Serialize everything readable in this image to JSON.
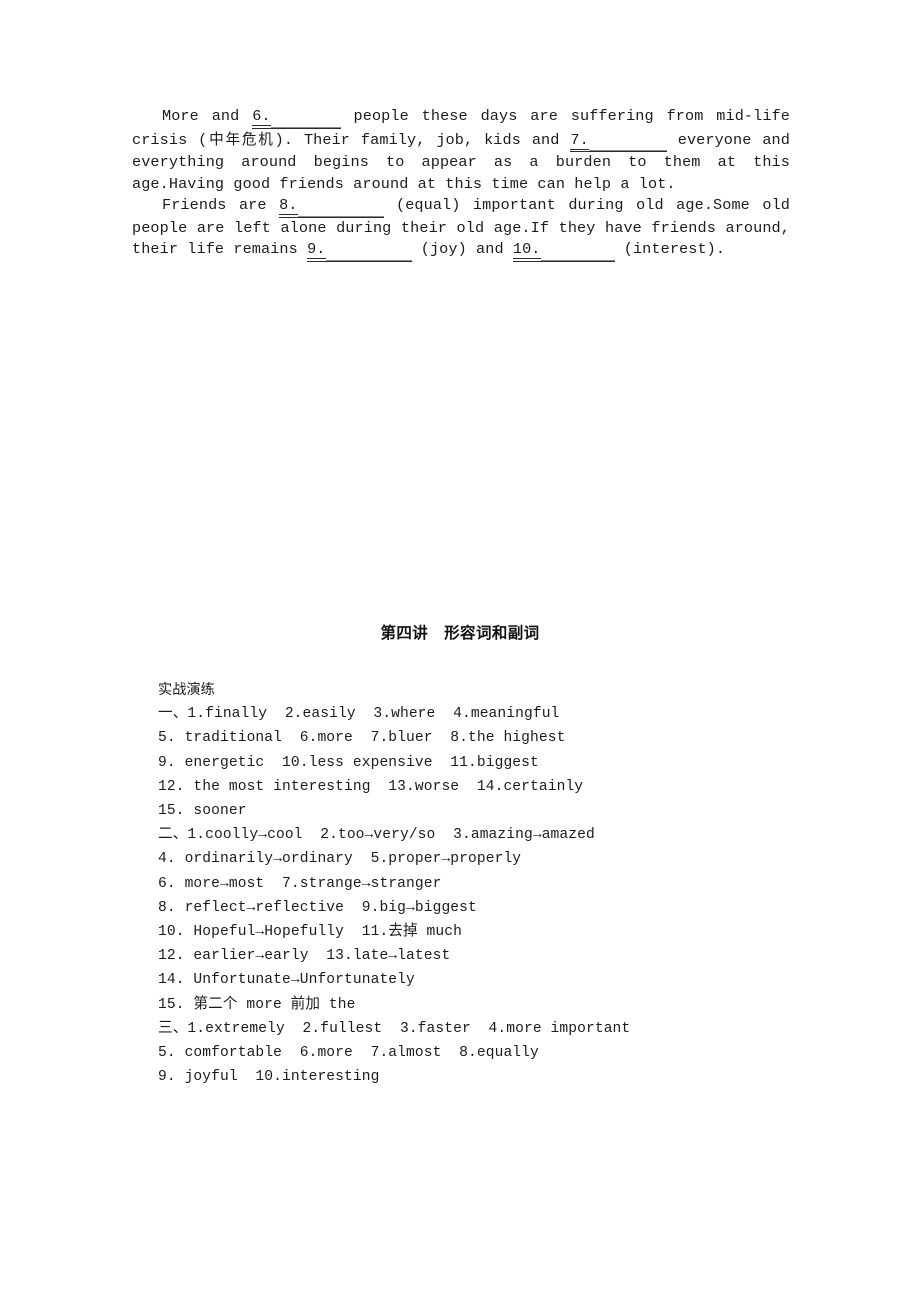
{
  "document": {
    "page_type": "textbook-answer-page"
  },
  "passage": {
    "paragraphs": [
      {
        "id": "p1",
        "segments": [
          {
            "type": "indent"
          },
          {
            "type": "text",
            "value": "More and "
          },
          {
            "type": "blank",
            "number": "6.",
            "width": "w70"
          },
          {
            "type": "text",
            "value": " people these days are suffering from mid-life crisis ("
          },
          {
            "type": "cjk",
            "value": "中年危机"
          },
          {
            "type": "text",
            "value": "). Their family, job, kids and "
          },
          {
            "type": "blank",
            "number": "7.",
            "width": "w78"
          },
          {
            "type": "text",
            "value": " everyone and everything around begins to appear as a burden to them at this age.Having good friends around at this time can help a lot."
          }
        ]
      },
      {
        "id": "p2",
        "segments": [
          {
            "type": "indent"
          },
          {
            "type": "text",
            "value": "Friends are "
          },
          {
            "type": "blank",
            "number": "8.",
            "width": "w86"
          },
          {
            "type": "text",
            "value": " (equal) important during old age.Some old people are left alone during their old age.If they have friends around, their life remains "
          },
          {
            "type": "blank",
            "number": "9.",
            "width": "w86"
          },
          {
            "type": "text",
            "value": " (joy) and "
          },
          {
            "type": "blank",
            "number": "10.",
            "width": "w74"
          },
          {
            "type": "text",
            "value": " (interest)."
          }
        ]
      }
    ],
    "raw_text": {
      "p1": "More and 6.________ people these days are suffering from mid-life crisis (中年危机). Their family, job, kids and 7.________ everyone and everything around begins to appear as a burden to them at this age.Having good friends around at this time can help a lot.",
      "p2": "Friends are 8.________ (equal) important during old age.Some old people are left alone during their old age.If they have friends around, their life remains 9.________ (joy) and 10.________ (interest)."
    }
  },
  "lecture_heading": {
    "number": "第四讲",
    "title": "形容词和副词"
  },
  "answer_key": {
    "title": "实战演练",
    "lines": [
      "一、1.finally  2.easily  3.where  4.meaningful",
      "5. traditional  6.more  7.bluer  8.the highest",
      "9. energetic  10.less expensive  11.biggest",
      "12. the most interesting  13.worse  14.certainly",
      "15. sooner",
      "二、1.coolly→cool  2.too→very/so  3.amazing→amazed",
      "4. ordinarily→ordinary  5.proper→properly",
      "6. more→most  7.strange→stranger",
      "8. reflect→reflective  9.big→biggest",
      "10. Hopeful→Hopefully  11.去掉 much",
      "12. earlier→early  13.late→latest",
      "14. Unfortunate→Unfortunately",
      "15. 第二个 more 前加 the",
      "三、1.extremely  2.fullest  3.faster  4.more important",
      "5. comfortable  6.more  7.almost  8.equally",
      "9. joyful  10.interesting"
    ]
  }
}
